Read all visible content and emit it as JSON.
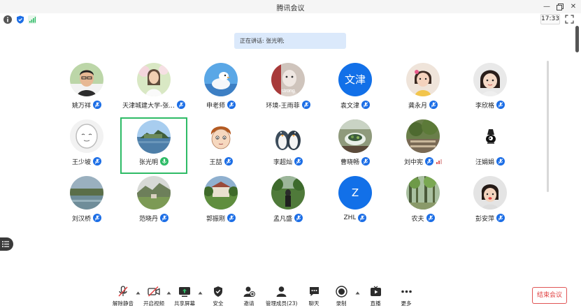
{
  "window": {
    "title": "腾讯会议"
  },
  "status": {
    "time": "17:33"
  },
  "banner": {
    "speaking": "正在讲话: 张光明;"
  },
  "participants": [
    {
      "name": "姚万祥"
    },
    {
      "name": "天津城建大学-张..."
    },
    {
      "name": "申老师"
    },
    {
      "name": "环境-王雨菲",
      "photo_caption": "strong"
    },
    {
      "name": "袁文津",
      "avatar_text": "文津"
    },
    {
      "name": "龚永月"
    },
    {
      "name": "李欣格"
    },
    {
      "name": "王少坡"
    },
    {
      "name": "张光明"
    },
    {
      "name": "王喆"
    },
    {
      "name": "李超灿"
    },
    {
      "name": "曹晓畅"
    },
    {
      "name": "刘中宪"
    },
    {
      "name": "汪娟娟"
    },
    {
      "name": "刘汉桥"
    },
    {
      "name": "范晓丹"
    },
    {
      "name": "郭振刚"
    },
    {
      "name": "孟凡盛"
    },
    {
      "name": "ZHL",
      "avatar_text": "Z"
    },
    {
      "name": "农夫"
    },
    {
      "name": "彭安萍"
    }
  ],
  "toolbar": {
    "unmute": "解除静音",
    "video": "开启视频",
    "share": "共享屏幕",
    "security": "安全",
    "invite": "邀请",
    "members": "管理成员(23)",
    "chat": "聊天",
    "record": "录制",
    "live": "直播",
    "more": "更多",
    "end": "结束会议"
  },
  "colors": {
    "accent": "#1c6ee6",
    "speaking": "#2ebb66",
    "end": "#e04040"
  }
}
